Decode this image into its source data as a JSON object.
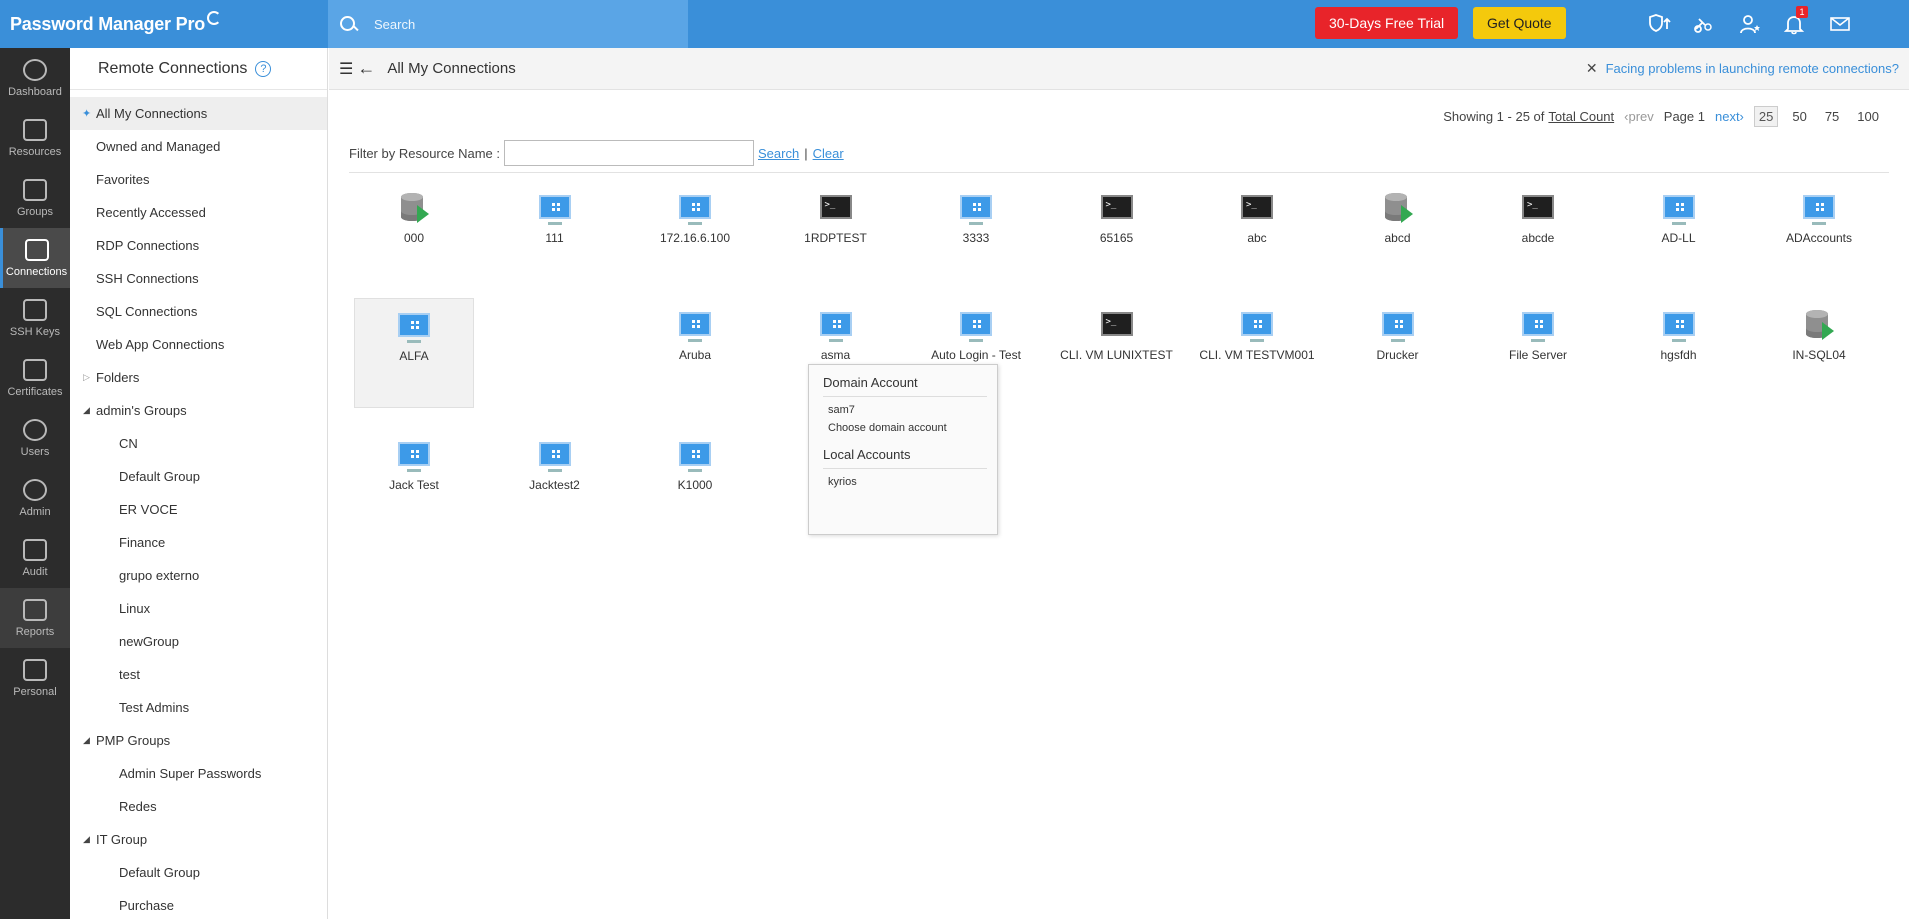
{
  "topbar": {
    "brand": "Password Manager Pro",
    "search_placeholder": "Search",
    "trial_label": "30-Days Free Trial",
    "quote_label": "Get Quote",
    "notification_count": "1",
    "icons": [
      "shield-up-icon",
      "link-gear-icon",
      "user-star-icon",
      "bell-icon",
      "mail-icon"
    ]
  },
  "leftnav": {
    "items": [
      {
        "label": "Dashboard",
        "icon": "dashboard-icon"
      },
      {
        "label": "Resources",
        "icon": "monitor-icon"
      },
      {
        "label": "Groups",
        "icon": "groups-icon"
      },
      {
        "label": "Connections",
        "icon": "connections-icon"
      },
      {
        "label": "SSH Keys",
        "icon": "key-icon"
      },
      {
        "label": "Certificates",
        "icon": "certificate-icon"
      },
      {
        "label": "Users",
        "icon": "user-icon"
      },
      {
        "label": "Admin",
        "icon": "gear-icon"
      },
      {
        "label": "Audit",
        "icon": "audit-icon"
      },
      {
        "label": "Reports",
        "icon": "reports-icon"
      },
      {
        "label": "Personal",
        "icon": "personal-icon"
      }
    ],
    "active": "Connections"
  },
  "tree": {
    "title": "Remote Connections",
    "help": "?",
    "items": [
      {
        "label": "All My Connections"
      },
      {
        "label": "Owned and Managed"
      },
      {
        "label": "Favorites"
      },
      {
        "label": "Recently Accessed"
      },
      {
        "label": "RDP Connections"
      },
      {
        "label": "SSH Connections"
      },
      {
        "label": "SQL Connections"
      },
      {
        "label": "Web App Connections"
      },
      {
        "label": "Folders"
      }
    ],
    "groups": [
      {
        "label": "admin's Groups",
        "children": [
          "CN",
          "Default Group",
          "ER VOCE",
          "Finance",
          "grupo externo",
          "Linux",
          "newGroup",
          "test",
          "Test Admins"
        ]
      },
      {
        "label": "PMP Groups",
        "children": [
          "Admin Super Passwords",
          "Redes"
        ]
      },
      {
        "label": "IT Group",
        "children": [
          "Default Group",
          "Purchase"
        ]
      }
    ]
  },
  "main": {
    "title": "All My Connections",
    "help_link": "Facing problems in launching remote connections?",
    "pager": {
      "showing": "Showing 1 - 25 of",
      "total": "Total Count",
      "prev": "‹prev",
      "page": "Page 1",
      "next": "next›",
      "sizes": [
        "25",
        "50",
        "75",
        "100"
      ]
    },
    "filter": {
      "label": "Filter by Resource Name :",
      "value": "",
      "search": "Search",
      "sep": "|",
      "clear": "Clear"
    },
    "tiles": [
      {
        "name": "000",
        "type": "db"
      },
      {
        "name": "111",
        "type": "win"
      },
      {
        "name": "172.16.6.100",
        "type": "win"
      },
      {
        "name": "1RDPTEST",
        "type": "term"
      },
      {
        "name": "3333",
        "type": "win"
      },
      {
        "name": "65165",
        "type": "term"
      },
      {
        "name": "abc",
        "type": "term"
      },
      {
        "name": "abcd",
        "type": "db"
      },
      {
        "name": "abcde",
        "type": "term"
      },
      {
        "name": "AD-LL",
        "type": "win"
      },
      {
        "name": "ADAccounts",
        "type": "win"
      },
      {
        "name": "ALFA",
        "type": "win"
      },
      {
        "name": "Aruba",
        "type": "win"
      },
      {
        "name": "asma",
        "type": "win"
      },
      {
        "name": "Auto Login - Test",
        "type": "win"
      },
      {
        "name": "CLI. VM LUNIXTEST",
        "type": "term"
      },
      {
        "name": "CLI. VM TESTVM001",
        "type": "win"
      },
      {
        "name": "Drucker",
        "type": "win"
      },
      {
        "name": "File Server",
        "type": "win"
      },
      {
        "name": "hgsfdh",
        "type": "win"
      },
      {
        "name": "IN-SQL04",
        "type": "db"
      },
      {
        "name": "Jack Test",
        "type": "win"
      },
      {
        "name": "Jacktest2",
        "type": "win"
      },
      {
        "name": "K1000",
        "type": "win"
      }
    ],
    "popup": {
      "domain_header": "Domain Account",
      "domain_items": [
        "sam7",
        "Choose domain account"
      ],
      "local_header": "Local Accounts",
      "local_items": [
        "kyrios"
      ]
    }
  }
}
